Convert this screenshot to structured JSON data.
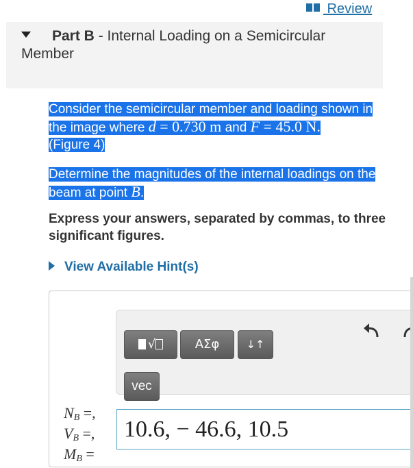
{
  "review": {
    "label": " Review"
  },
  "part": {
    "prefix": "Part B",
    "separator": " - ",
    "title": "Internal Loading on a Semicircular Member"
  },
  "problem": {
    "p1_text1": "Consider the semicircular member and loading shown in the image where ",
    "p1_var_d": "d",
    "p1_val_d": "0.730 m",
    "p1_and": " and ",
    "p1_var_F": "F",
    "p1_val_F": "45.0 N",
    "p1_period": ".",
    "p1_figure": "(Figure 4)",
    "p2_text": "Determine the magnitudes of the internal loadings on the beam at point ",
    "p2_var": "B",
    "p2_period": "."
  },
  "instructions": "Express your answers, separated by commas, to three significant figures.",
  "hint": {
    "label": "View Available Hint(s)"
  },
  "toolbar": {
    "greek_label": "ΑΣφ",
    "arrows_label": "↓↑",
    "vec_label": "vec"
  },
  "icons": {
    "templates": "templates-icon",
    "undo": "undo-icon",
    "redo": "redo-icon",
    "book": "book-icon"
  },
  "answer": {
    "labels": [
      {
        "letter": "N",
        "sub": "B",
        "suffix": " =,"
      },
      {
        "letter": "V",
        "sub": "B",
        "suffix": " =,"
      },
      {
        "letter": "M",
        "sub": "B",
        "suffix": " ="
      }
    ],
    "value": "10.6, − 46.6, 10.5"
  },
  "colors": {
    "highlight": "#1a73e8",
    "link": "#1f6ea5",
    "input_border": "#58a4c2"
  }
}
